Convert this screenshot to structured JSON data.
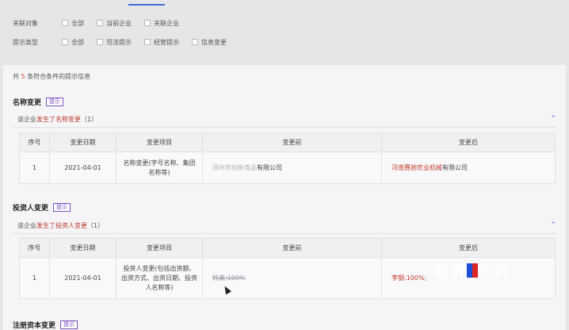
{
  "filters": {
    "related": {
      "label": "关联对象",
      "options": [
        "全部",
        "当前企业",
        "关联企业"
      ]
    },
    "types": {
      "label": "提示类型",
      "options": [
        "全部",
        "司法提示",
        "经营提示",
        "信息变更"
      ]
    }
  },
  "summary": {
    "prefix": "共",
    "count": "5",
    "suffix": "条符合条件的提示信息"
  },
  "sections": [
    {
      "title": "名称变更",
      "tag": "提示",
      "sub_prefix": "该企业",
      "sub_highlight": "发生了名称变更",
      "sub_count": "（1）",
      "headers": [
        "序号",
        "变更日期",
        "变更项目",
        "变更前",
        "变更后"
      ],
      "row": {
        "no": "1",
        "date": "2021-04-01",
        "item": "名称变更(字号名称、集团名称等)",
        "before_blur": "郑州市创新食品",
        "before_rest": "有限公司",
        "after_red": "河南赛驰农业机械",
        "after_rest": "有限公司"
      }
    },
    {
      "title": "投资人变更",
      "tag": "提示",
      "sub_prefix": "该企业",
      "sub_highlight": "发生了投资人变更",
      "sub_count": "（1）",
      "headers": [
        "序号",
        "变更日期",
        "变更项目",
        "变更前",
        "变更后"
      ],
      "row": {
        "no": "1",
        "date": "2021-04-01",
        "item": "投资人变更(包括出资额、出资方式、出资日期、投资人名称等)",
        "before": "韩某:100%",
        "after": "李钢:100%;"
      }
    },
    {
      "title": "注册资本变更",
      "tag": "提示"
    }
  ],
  "watermark": {
    "left": "经济",
    "right": "小时"
  }
}
